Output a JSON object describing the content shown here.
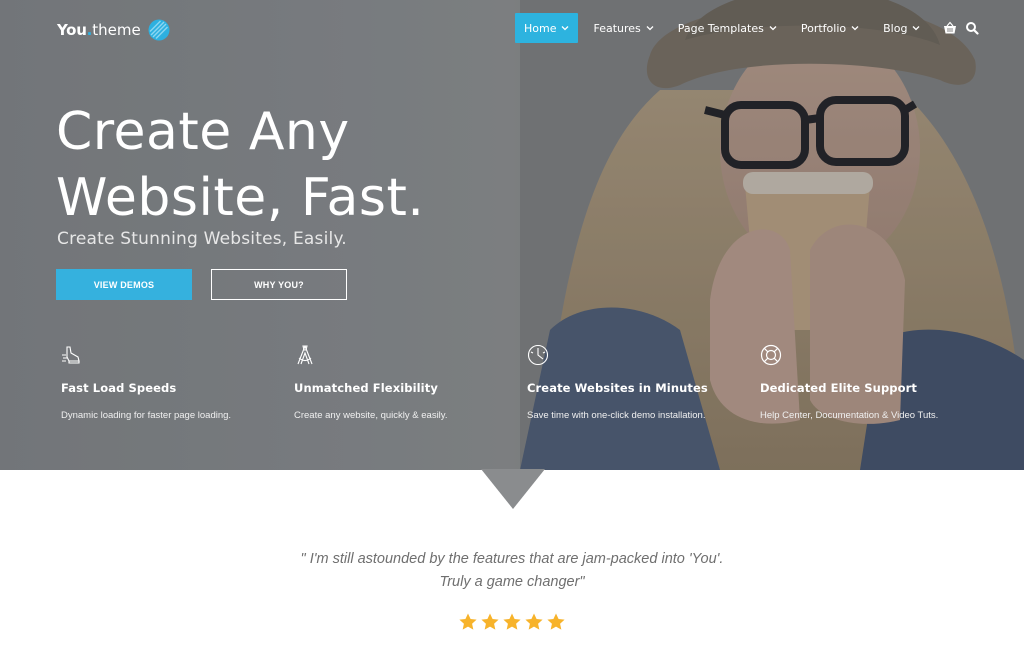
{
  "brand": {
    "name_part1": "You",
    "name_dot": ".",
    "name_part2": "theme",
    "accent_color": "#2db3df"
  },
  "nav": {
    "items": [
      {
        "label": "Home",
        "active": true
      },
      {
        "label": "Features",
        "active": false
      },
      {
        "label": "Page Templates",
        "active": false
      },
      {
        "label": "Portfolio",
        "active": false
      },
      {
        "label": "Blog",
        "active": false
      }
    ],
    "icons": [
      "basket-icon",
      "search-icon"
    ]
  },
  "hero": {
    "headline_line1": "Create Any",
    "headline_line2": "Website, Fast.",
    "subheadline": "Create Stunning Websites, Easily.",
    "primary_button": "VIEW DEMOS",
    "secondary_button": "WHY YOU?"
  },
  "features": [
    {
      "icon": "running-shoe-icon",
      "title": "Fast Load Speeds",
      "description": "Dynamic loading for faster page loading."
    },
    {
      "icon": "compass-drafting-icon",
      "title": "Unmatched Flexibility",
      "description": "Create any website, quickly & easily."
    },
    {
      "icon": "clock-icon",
      "title": "Create Websites in Minutes",
      "description": "Save time with one-click demo installation."
    },
    {
      "icon": "lifebuoy-icon",
      "title": "Dedicated Elite Support",
      "description": "Help Center, Documentation & Video Tuts."
    }
  ],
  "testimonial": {
    "line1": "\" I'm still astounded by the features that are jam-packed into 'You'.",
    "line2": "Truly a game changer\"",
    "rating": 5,
    "rating_max": 5,
    "star_color": "#f7b32b"
  }
}
